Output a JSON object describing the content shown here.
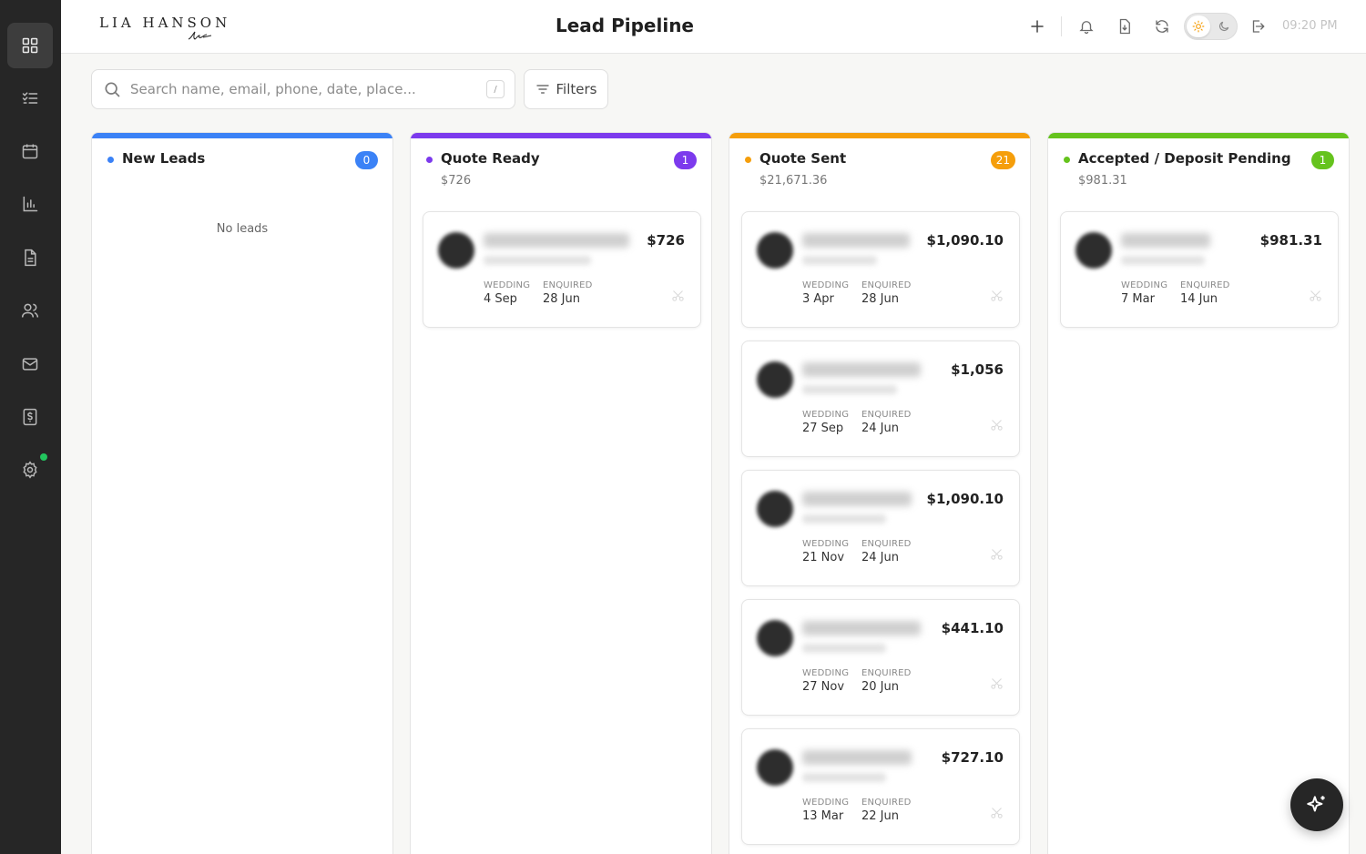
{
  "app": {
    "logo_text": "LIA HANSON",
    "page_title": "Lead Pipeline",
    "time": "09:20 PM"
  },
  "sidebar": {
    "items": [
      {
        "icon": "grid-icon",
        "active": true
      },
      {
        "icon": "checklist-icon",
        "active": false
      },
      {
        "icon": "calendar-icon",
        "active": false
      },
      {
        "icon": "bar-chart-icon",
        "active": false
      },
      {
        "icon": "document-icon",
        "active": false
      },
      {
        "icon": "users-icon",
        "active": false
      },
      {
        "icon": "mail-icon",
        "active": false
      },
      {
        "icon": "invoice-icon",
        "active": false
      },
      {
        "icon": "gear-icon",
        "active": false
      }
    ]
  },
  "toolbar": {
    "icons": [
      "plus-icon",
      "bell-icon",
      "file-download-icon",
      "refresh-icon",
      "sun-icon",
      "moon-icon",
      "logout-icon"
    ]
  },
  "search": {
    "placeholder": "Search name, email, phone, date, place...",
    "shortcut": "/"
  },
  "filters": {
    "label": "Filters"
  },
  "colors": {
    "new": "#3b82f6",
    "quote_ready": "#7c3aed",
    "quote_sent": "#f59e0b",
    "accepted": "#65c31d",
    "sidebar_bg": "#262626"
  },
  "columns": [
    {
      "title": "New Leads",
      "count": "0",
      "total": "",
      "empty_text": "No leads",
      "cards": []
    },
    {
      "title": "Quote Ready",
      "count": "1",
      "total": "$726",
      "cards": [
        {
          "amount": "$726",
          "wedding_label": "WEDDING",
          "wedding": "4 Sep",
          "enquired_label": "ENQUIRED",
          "enquired": "28 Jun"
        }
      ]
    },
    {
      "title": "Quote Sent",
      "count": "21",
      "total": "$21,671.36",
      "cards": [
        {
          "amount": "$1,090.10",
          "wedding_label": "WEDDING",
          "wedding": "3 Apr",
          "enquired_label": "ENQUIRED",
          "enquired": "28 Jun"
        },
        {
          "amount": "$1,056",
          "wedding_label": "WEDDING",
          "wedding": "27 Sep",
          "enquired_label": "ENQUIRED",
          "enquired": "24 Jun"
        },
        {
          "amount": "$1,090.10",
          "wedding_label": "WEDDING",
          "wedding": "21 Nov",
          "enquired_label": "ENQUIRED",
          "enquired": "24 Jun"
        },
        {
          "amount": "$441.10",
          "wedding_label": "WEDDING",
          "wedding": "27 Nov",
          "enquired_label": "ENQUIRED",
          "enquired": "20 Jun"
        },
        {
          "amount": "$727.10",
          "wedding_label": "WEDDING",
          "wedding": "13 Mar",
          "enquired_label": "ENQUIRED",
          "enquired": "22 Jun"
        }
      ]
    },
    {
      "title": "Accepted / Deposit Pending",
      "count": "1",
      "total": "$981.31",
      "cards": [
        {
          "amount": "$981.31",
          "wedding_label": "WEDDING",
          "wedding": "7 Mar",
          "enquired_label": "ENQUIRED",
          "enquired": "14 Jun"
        }
      ]
    }
  ],
  "fab": {
    "icon": "sparkles-icon"
  }
}
